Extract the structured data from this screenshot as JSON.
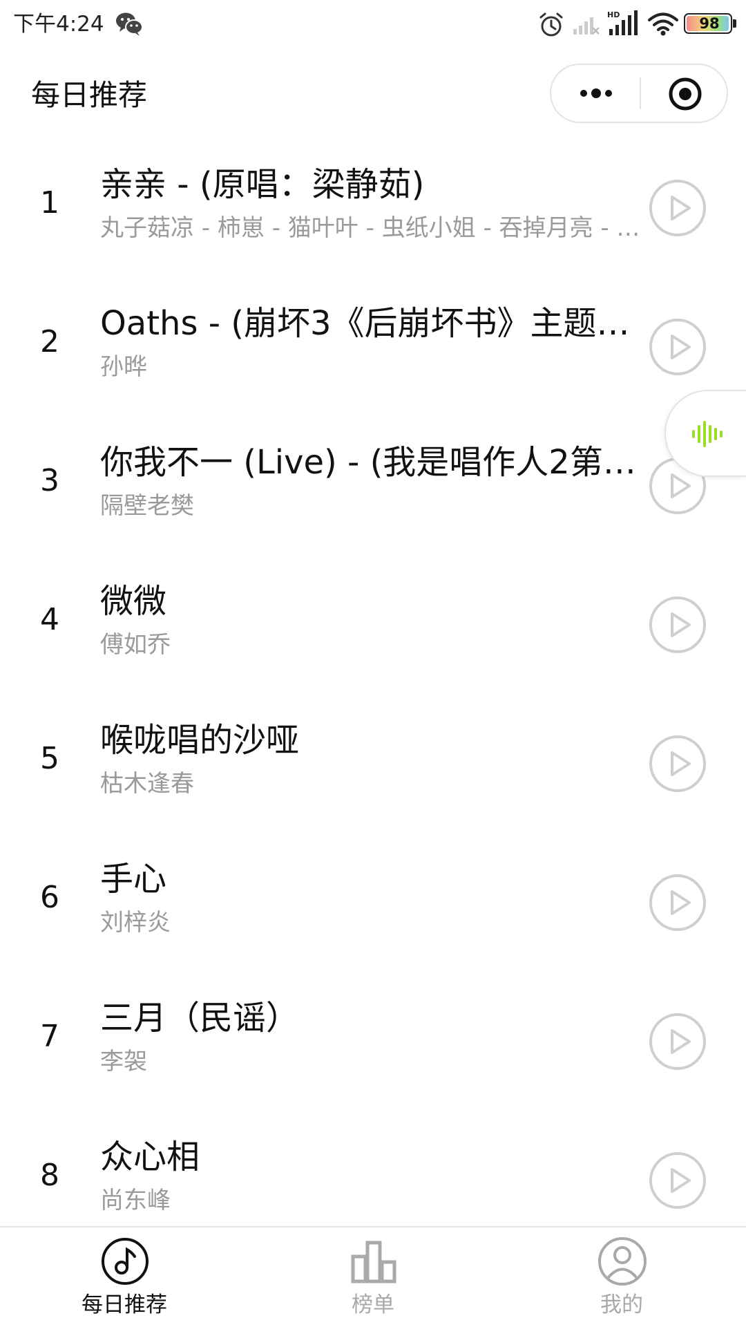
{
  "status_bar": {
    "time": "下午4:24",
    "battery": "98",
    "battery_fraction": 0.98,
    "signal_hd_label": "HD"
  },
  "header": {
    "title": "每日推荐"
  },
  "songs": [
    {
      "rank": "1",
      "title": "亲亲 - (原唱：梁静茹)",
      "artist": "丸子菇凉 - 柿崽 - 猫叶叶 - 虫纸小姐 - 吞掉月亮 - …"
    },
    {
      "rank": "2",
      "title": "Oaths - (崩坏3《后崩坏书》主题…",
      "artist": "孙晔"
    },
    {
      "rank": "3",
      "title": "你我不一 (Live) - (我是唱作人2第…",
      "artist": "隔壁老樊"
    },
    {
      "rank": "4",
      "title": "微微",
      "artist": "傅如乔"
    },
    {
      "rank": "5",
      "title": "喉咙唱的沙哑",
      "artist": "枯木逢春"
    },
    {
      "rank": "6",
      "title": "手心",
      "artist": "刘梓炎"
    },
    {
      "rank": "7",
      "title": "三月（民谣）",
      "artist": "李袈"
    },
    {
      "rank": "8",
      "title": "众心相",
      "artist": "尚东峰"
    }
  ],
  "tabs": [
    {
      "label": "每日推荐",
      "icon": "music-note-icon",
      "active": true
    },
    {
      "label": "榜单",
      "icon": "chart-icon",
      "active": false
    },
    {
      "label": "我的",
      "icon": "user-icon",
      "active": false
    }
  ],
  "colors": {
    "accent_green": "#9bdc2a",
    "text_primary": "#111111",
    "text_secondary": "#9a9a9a",
    "tab_inactive": "#a9a9a9",
    "play_button": "#cfcfcf"
  }
}
